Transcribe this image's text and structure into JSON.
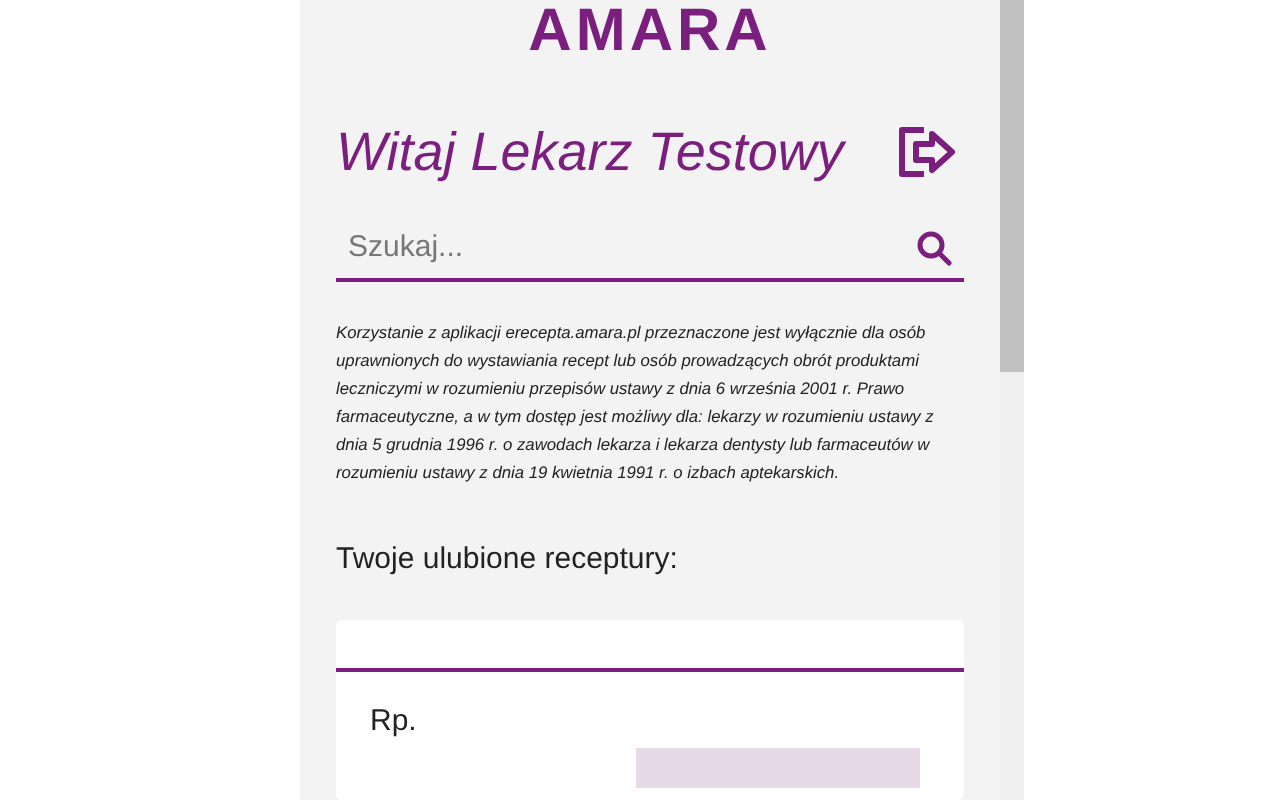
{
  "logo": {
    "text": "AMARA"
  },
  "greeting": "Witaj Lekarz Testowy",
  "search": {
    "placeholder": "Szukaj..."
  },
  "disclaimer": "Korzystanie z aplikacji erecepta.amara.pl przeznaczone jest wyłącznie dla osób uprawnionych do wystawiania recept lub osób prowadzących obrót produktami leczniczymi w rozumieniu przepisów ustawy z dnia 6 września 2001 r. Prawo farmaceutyczne, a w tym dostęp jest możliwy dla: lekarzy w rozumieniu ustawy z dnia 5 grudnia 1996 r. o zawodach lekarza i lekarza dentysty lub farmaceutów w rozumieniu ustawy z dnia 19 kwietnia 1991 r. o izbach aptekarskich.",
  "favorites_heading": "Twoje ulubione receptury:",
  "recipe_card": {
    "prefix": "Rp."
  }
}
